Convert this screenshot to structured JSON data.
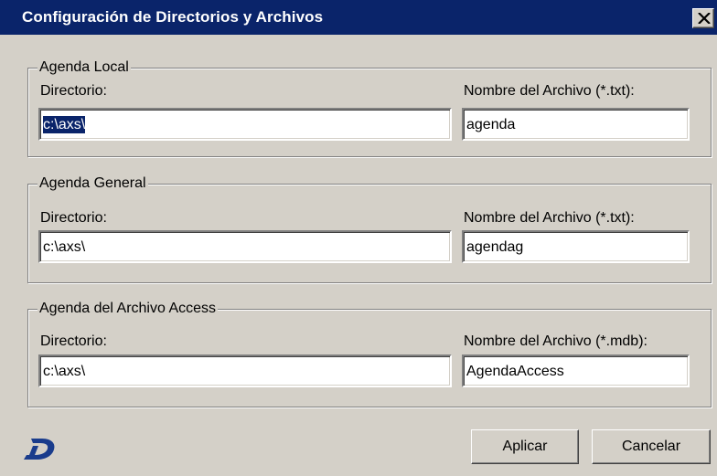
{
  "window": {
    "title": "Configuración de Directorios y Archivos"
  },
  "groups": [
    {
      "legend": "Agenda Local",
      "dir_label": "Directorio:",
      "dir_value": "c:\\axs\\",
      "file_label": "Nombre del Archivo (*.txt):",
      "file_value": "agenda"
    },
    {
      "legend": "Agenda General",
      "dir_label": "Directorio:",
      "dir_value": "c:\\axs\\",
      "file_label": "Nombre del Archivo (*.txt):",
      "file_value": "agendag"
    },
    {
      "legend": "Agenda del Archivo Access",
      "dir_label": "Directorio:",
      "dir_value": "c:\\axs\\",
      "file_label": "Nombre del Archivo (*.mdb):",
      "file_value": "AgendaAccess"
    }
  ],
  "buttons": {
    "apply": "Aplicar",
    "cancel": "Cancelar"
  },
  "icons": {
    "close": "close-icon",
    "logo": "logo-d-icon"
  },
  "colors": {
    "titlebar": "#0a246a",
    "face": "#d4d0c8",
    "logo": "#1a3c8c"
  }
}
